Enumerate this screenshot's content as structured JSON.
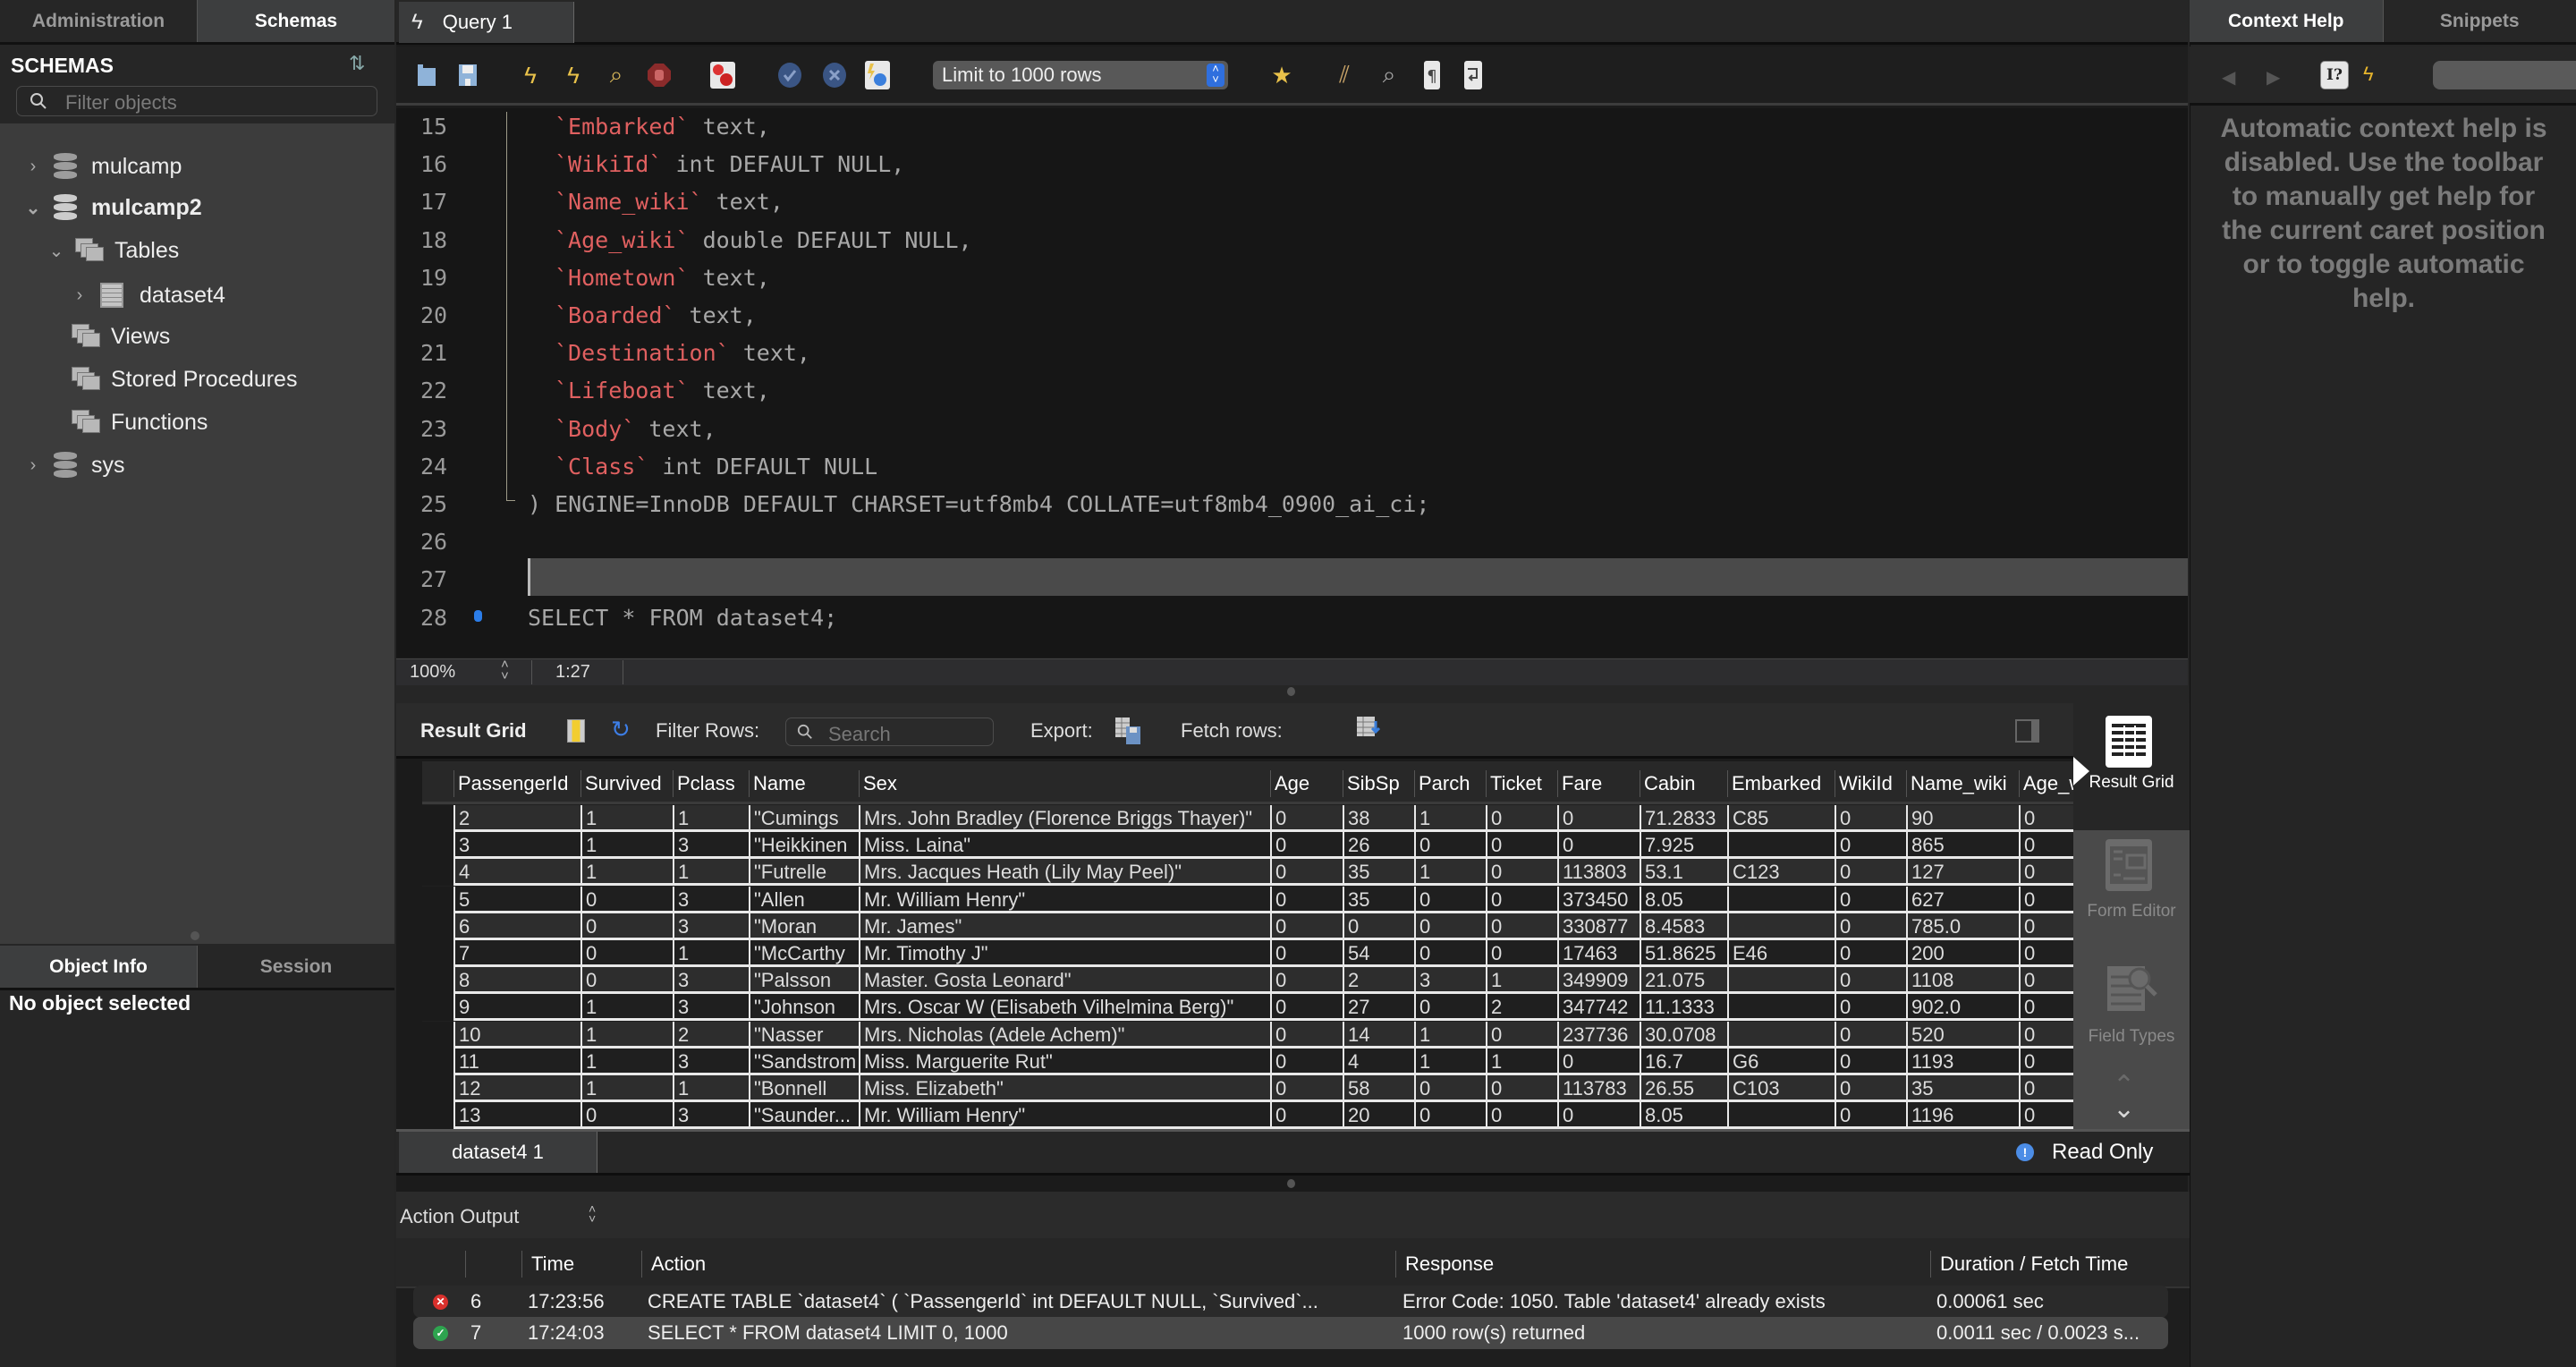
{
  "left_panel": {
    "tabs": [
      {
        "label": "Administration",
        "active": false
      },
      {
        "label": "Schemas",
        "active": true
      }
    ],
    "schemas_title": "SCHEMAS",
    "filter_placeholder": "Filter objects",
    "tree": [
      {
        "label": "mulcamp",
        "type": "schema",
        "expanded": false
      },
      {
        "label": "mulcamp2",
        "type": "schema",
        "expanded": true,
        "bold": true
      },
      {
        "label": "Tables",
        "type": "group",
        "expanded": true
      },
      {
        "label": "dataset4",
        "type": "table",
        "expanded": false
      },
      {
        "label": "Views",
        "type": "group"
      },
      {
        "label": "Stored Procedures",
        "type": "group"
      },
      {
        "label": "Functions",
        "type": "group"
      },
      {
        "label": "sys",
        "type": "schema",
        "expanded": false
      }
    ],
    "lower_tabs": [
      {
        "label": "Object Info",
        "active": true
      },
      {
        "label": "Session",
        "active": false
      }
    ],
    "object_info_text": "No object selected"
  },
  "query_tab": {
    "label": "Query 1"
  },
  "toolbar": {
    "icons": [
      "open-folder-icon",
      "save-icon",
      "execute-icon",
      "execute-current-icon",
      "explain-icon",
      "stop-icon",
      "toggle-continue-on-error-icon",
      "commit-icon",
      "rollback-icon",
      "autocommit-icon",
      "add-snippet-icon",
      "beautify-icon",
      "find-icon",
      "invisible-chars-icon",
      "word-wrap-icon"
    ],
    "limit_select": "Limit to 1000 rows"
  },
  "editor": {
    "lines": [
      {
        "n": "15",
        "id": "`Embarked`",
        "rest": " text,"
      },
      {
        "n": "16",
        "id": "`WikiId`",
        "rest": " int DEFAULT NULL,"
      },
      {
        "n": "17",
        "id": "`Name_wiki`",
        "rest": " text,"
      },
      {
        "n": "18",
        "id": "`Age_wiki`",
        "rest": " double DEFAULT NULL,"
      },
      {
        "n": "19",
        "id": "`Hometown`",
        "rest": " text,"
      },
      {
        "n": "20",
        "id": "`Boarded`",
        "rest": " text,"
      },
      {
        "n": "21",
        "id": "`Destination`",
        "rest": " text,"
      },
      {
        "n": "22",
        "id": "`Lifeboat`",
        "rest": " text,"
      },
      {
        "n": "23",
        "id": "`Body`",
        "rest": " text,"
      },
      {
        "n": "24",
        "id": "`Class`",
        "rest": " int DEFAULT NULL"
      },
      {
        "n": "25",
        "id": "",
        "rest": ") ENGINE=InnoDB DEFAULT CHARSET=utf8mb4 COLLATE=utf8mb4_0900_ai_ci;"
      },
      {
        "n": "26",
        "id": "",
        "rest": ""
      },
      {
        "n": "27",
        "id": "",
        "rest": ""
      },
      {
        "n": "28",
        "id": "",
        "rest": "SELECT * FROM dataset4;"
      }
    ],
    "zoom": "100%",
    "caret_position": "1:27"
  },
  "result_grid": {
    "label": "Result Grid",
    "filter_label": "Filter Rows:",
    "search_placeholder": "Search",
    "export_label": "Export:",
    "fetch_label": "Fetch rows:",
    "columns": [
      "PassengerId",
      "Survived",
      "Pclass",
      "Name",
      "Sex",
      "Age",
      "SibSp",
      "Parch",
      "Ticket",
      "Fare",
      "Cabin",
      "Embarked",
      "WikiId",
      "Name_wiki",
      "Age_wiki"
    ],
    "rows": [
      [
        "2",
        "1",
        "1",
        "\"Cumings",
        "Mrs. John Bradley (Florence Briggs Thayer)\"",
        "0",
        "38",
        "1",
        "0",
        "0",
        "71.2833",
        "C85",
        "0",
        "90",
        "0"
      ],
      [
        "3",
        "1",
        "3",
        "\"Heikkinen",
        "Miss. Laina\"",
        "0",
        "26",
        "0",
        "0",
        "0",
        "7.925",
        "",
        "0",
        "865",
        "0"
      ],
      [
        "4",
        "1",
        "1",
        "\"Futrelle",
        "Mrs. Jacques Heath (Lily May Peel)\"",
        "0",
        "35",
        "1",
        "0",
        "113803",
        "53.1",
        "C123",
        "0",
        "127",
        "0"
      ],
      [
        "5",
        "0",
        "3",
        "\"Allen",
        "Mr. William Henry\"",
        "0",
        "35",
        "0",
        "0",
        "373450",
        "8.05",
        "",
        "0",
        "627",
        "0"
      ],
      [
        "6",
        "0",
        "3",
        "\"Moran",
        "Mr. James\"",
        "0",
        "0",
        "0",
        "0",
        "330877",
        "8.4583",
        "",
        "0",
        "785.0",
        "0"
      ],
      [
        "7",
        "0",
        "1",
        "\"McCarthy",
        "Mr. Timothy J\"",
        "0",
        "54",
        "0",
        "0",
        "17463",
        "51.8625",
        "E46",
        "0",
        "200",
        "0"
      ],
      [
        "8",
        "0",
        "3",
        "\"Palsson",
        "Master. Gosta Leonard\"",
        "0",
        "2",
        "3",
        "1",
        "349909",
        "21.075",
        "",
        "0",
        "1108",
        "0"
      ],
      [
        "9",
        "1",
        "3",
        "\"Johnson",
        "Mrs. Oscar W (Elisabeth Vilhelmina Berg)\"",
        "0",
        "27",
        "0",
        "2",
        "347742",
        "11.1333",
        "",
        "0",
        "902.0",
        "0"
      ],
      [
        "10",
        "1",
        "2",
        "\"Nasser",
        "Mrs. Nicholas (Adele Achem)\"",
        "0",
        "14",
        "1",
        "0",
        "237736",
        "30.0708",
        "",
        "0",
        "520",
        "0"
      ],
      [
        "11",
        "1",
        "3",
        "\"Sandstrom",
        "Miss. Marguerite Rut\"",
        "0",
        "4",
        "1",
        "1",
        "0",
        "16.7",
        "G6",
        "0",
        "1193",
        "0"
      ],
      [
        "12",
        "1",
        "1",
        "\"Bonnell",
        "Miss. Elizabeth\"",
        "0",
        "58",
        "0",
        "0",
        "113783",
        "26.55",
        "C103",
        "0",
        "35",
        "0"
      ],
      [
        "13",
        "0",
        "3",
        "\"Saunder...",
        "Mr. William Henry\"",
        "0",
        "20",
        "0",
        "0",
        "0",
        "8.05",
        "",
        "0",
        "1196",
        "0"
      ]
    ],
    "side_buttons": [
      {
        "label": "Result Grid",
        "active": true
      },
      {
        "label": "Form Editor",
        "active": false
      },
      {
        "label": "Field Types",
        "active": false
      }
    ],
    "result_tab": "dataset4 1",
    "read_only": "Read Only"
  },
  "action_output": {
    "label": "Action Output",
    "columns": [
      "",
      "Time",
      "Action",
      "Response",
      "Duration / Fetch Time"
    ],
    "rows": [
      {
        "status": "error",
        "num": "6",
        "time": "17:23:56",
        "action": "CREATE TABLE `dataset4` (   `PassengerId` int DEFAULT NULL,   `Survived`...",
        "response": "Error Code: 1050. Table 'dataset4' already exists",
        "duration": "0.00061 sec"
      },
      {
        "status": "ok",
        "num": "7",
        "time": "17:24:03",
        "action": "SELECT * FROM dataset4 LIMIT 0, 1000",
        "response": "1000 row(s) returned",
        "duration": "0.0011 sec / 0.0023 s..."
      }
    ]
  },
  "right_panel": {
    "tabs": [
      {
        "label": "Context Help",
        "active": true
      },
      {
        "label": "Snippets",
        "active": false
      }
    ],
    "help_text": "Automatic context help is disabled. Use the toolbar to manually get help for the current caret position or to toggle automatic help."
  },
  "colors": {
    "identifier": "#e06060",
    "accent_blue": "#2b7de9",
    "error_red": "#d9302c",
    "ok_green": "#2ea44f"
  }
}
